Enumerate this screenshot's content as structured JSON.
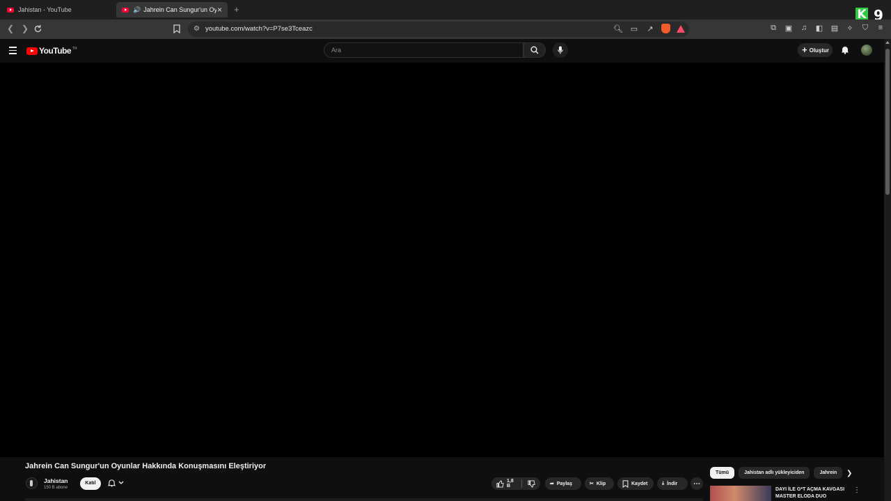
{
  "browser": {
    "tabs": [
      {
        "title": "Jahistan - YouTube",
        "active": false
      },
      {
        "title": "Jahrein Can Sungur'un Oyunla",
        "active": true
      }
    ],
    "new_tab": "+",
    "url": "youtube.com/watch?v=P7se3Tceazc",
    "brand_logo": {
      "letter": "K",
      "number": "9"
    }
  },
  "youtube": {
    "logo_text": "YouTube",
    "country_code": "TR",
    "search_placeholder": "Ara",
    "create_label": "Oluştur"
  },
  "video": {
    "title": "Jahrein Can Sungur'un Oyunlar Hakkında Konuşmasını Eleştiriyor",
    "channel": {
      "name": "Jahistan",
      "subscribers": "150 B abone"
    },
    "join_label": "Katıl",
    "actions": {
      "likes": "1,8 B",
      "share": "Paylaş",
      "clip": "Klip",
      "save": "Kaydet",
      "download": "İndir"
    }
  },
  "sidebar": {
    "chips": [
      "Tümü",
      "Jahistan adlı yükleyiciden",
      "Jahrein"
    ],
    "recommendation": {
      "title": "DAYI İLE G*T AÇMA KAVGASI MASTER ELODA DUO"
    }
  },
  "colors": {
    "youtube_red": "#ff0000",
    "background": "#0f0f0f",
    "accent_green": "#2ecc40"
  }
}
